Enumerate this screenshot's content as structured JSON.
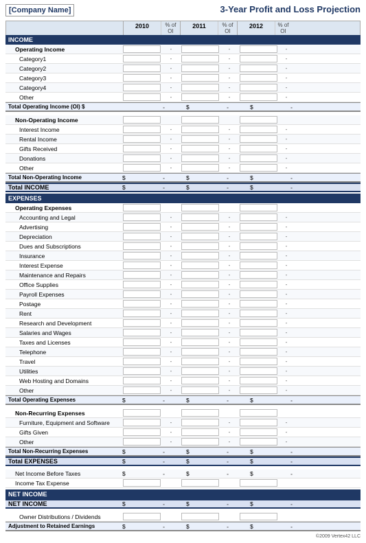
{
  "header": {
    "company_name": "[Company Name]",
    "title": "3-Year Profit and Loss Projection"
  },
  "columns": {
    "years": [
      "2010",
      "2011",
      "2012"
    ],
    "pct_label": "% of OI"
  },
  "income": {
    "section_label": "INCOME",
    "operating_income_label": "Operating Income",
    "categories": [
      "Category1",
      "Category2",
      "Category3",
      "Category4",
      "Other"
    ],
    "total_operating_income": "Total Operating Income (OI)  $",
    "non_operating_income_label": "Non-Operating Income",
    "non_op_categories": [
      "Interest Income",
      "Rental Income",
      "Gifts Received",
      "Donations",
      "Other"
    ],
    "total_non_operating": "Total Non-Operating Income",
    "total_income_label": "Total INCOME"
  },
  "expenses": {
    "section_label": "EXPENSES",
    "operating_expenses_label": "Operating Expenses",
    "op_exp_items": [
      "Accounting and Legal",
      "Advertising",
      "Depreciation",
      "Dues and Subscriptions",
      "Insurance",
      "Interest Expense",
      "Maintenance and Repairs",
      "Office Supplies",
      "Payroll Expenses",
      "Postage",
      "Rent",
      "Research and Development",
      "Salaries and Wages",
      "Taxes and Licenses",
      "Telephone",
      "Travel",
      "Utilities",
      "Web Hosting and Domains",
      "Other"
    ],
    "total_operating_expenses": "Total Operating Expenses",
    "non_recurring_label": "Non-Recurring Expenses",
    "non_rec_items": [
      "Furniture, Equipment and Software",
      "Gifts Given",
      "Other"
    ],
    "total_non_recurring": "Total Non-Recurring Expenses",
    "total_expenses_label": "Total EXPENSES",
    "net_before_taxes": "Net Income Before Taxes",
    "income_tax": "Income Tax Expense"
  },
  "net_income": {
    "section_label": "NET INCOME",
    "owner_distributions": "Owner Distributions / Dividends",
    "adjustment": "Adjustment to Retained Earnings"
  },
  "footer": {
    "copyright": "©2009 Vertex42 LLC"
  },
  "dash": "-",
  "dollar": "$"
}
